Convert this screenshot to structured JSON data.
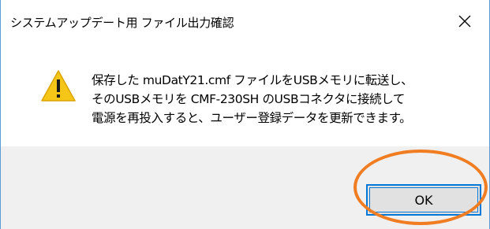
{
  "window": {
    "title": "システムアップデート用 ファイル出力確認",
    "close_icon": "close-icon"
  },
  "message": {
    "icon": "warning-icon",
    "icon_color": "#f5c518",
    "lines": [
      "保存した muDatY21.cmf ファイルをUSBメモリに転送し、",
      "そのUSBメモリを CMF-230SH のUSBコネクタに接続して",
      "電源を再投入すると、ユーザー登録データを更新できます。"
    ]
  },
  "buttons": {
    "ok_label": "OK",
    "focus_color": "#0078d7"
  },
  "annotation": {
    "highlight_color": "#f07d22"
  }
}
